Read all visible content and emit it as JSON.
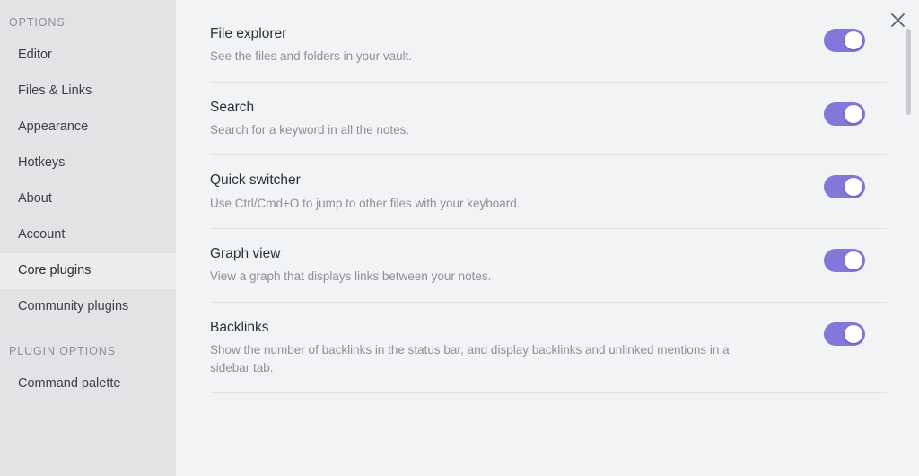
{
  "sidebar": {
    "sections": [
      {
        "label": "OPTIONS",
        "items": [
          {
            "label": "Editor",
            "active": false
          },
          {
            "label": "Files & Links",
            "active": false
          },
          {
            "label": "Appearance",
            "active": false
          },
          {
            "label": "Hotkeys",
            "active": false
          },
          {
            "label": "About",
            "active": false
          },
          {
            "label": "Account",
            "active": false
          },
          {
            "label": "Core plugins",
            "active": true
          },
          {
            "label": "Community plugins",
            "active": false
          }
        ]
      },
      {
        "label": "PLUGIN OPTIONS",
        "items": [
          {
            "label": "Command palette",
            "active": false
          }
        ]
      }
    ]
  },
  "header": {
    "close_icon": "close-icon"
  },
  "main": {
    "settings": [
      {
        "name": "File explorer",
        "description": "See the files and folders in your vault.",
        "enabled": true
      },
      {
        "name": "Search",
        "description": "Search for a keyword in all the notes.",
        "enabled": true
      },
      {
        "name": "Quick switcher",
        "description": "Use Ctrl/Cmd+O to jump to other files with your keyboard.",
        "enabled": true
      },
      {
        "name": "Graph view",
        "description": "View a graph that displays links between your notes.",
        "enabled": true
      },
      {
        "name": "Backlinks",
        "description": "Show the number of backlinks in the status bar, and display backlinks and unlinked mentions in a sidebar tab.",
        "enabled": true
      }
    ]
  },
  "colors": {
    "accent": "#8377d9",
    "sidebar_bg": "#e3e3e6",
    "content_bg": "#f2f3f5",
    "active_item_bg": "#ececed",
    "muted_text": "#8d8f95"
  }
}
